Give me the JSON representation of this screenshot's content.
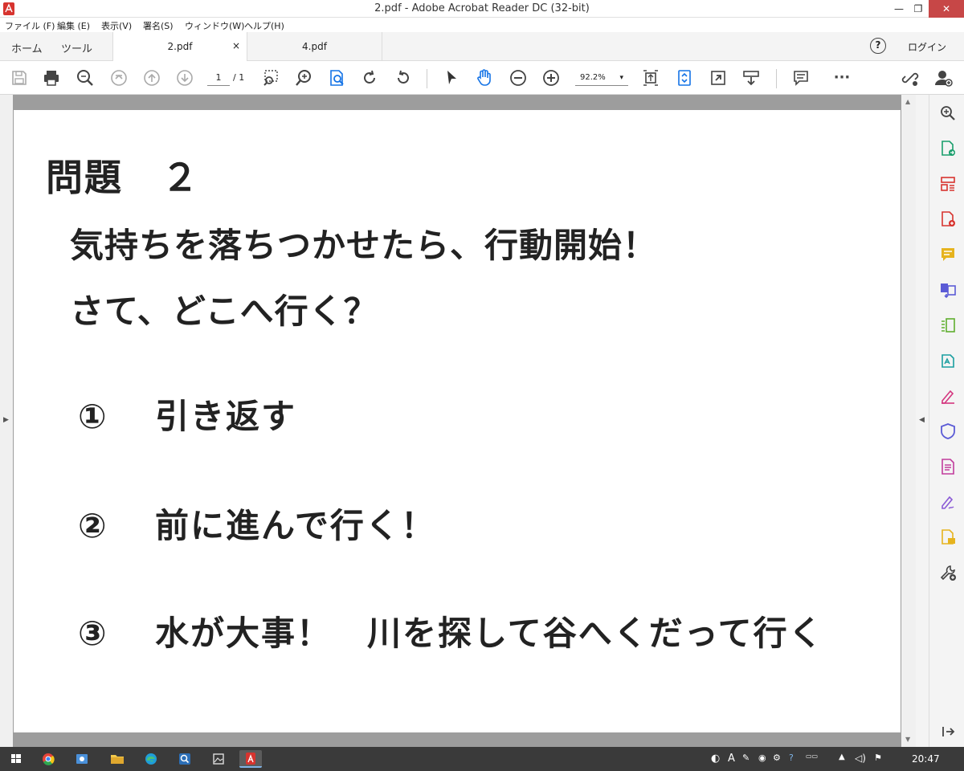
{
  "window": {
    "title": "2.pdf - Adobe Acrobat Reader DC (32-bit)",
    "min": "—",
    "max": "❐",
    "close": "✕"
  },
  "menu": [
    "ファイル (F)",
    "編集 (E)",
    "表示(V)",
    "署名(S)",
    "ウィンドウ(W)",
    "ヘルプ(H)"
  ],
  "tabs": {
    "home": "ホーム",
    "tools": "ツール",
    "doc_active": "2.pdf",
    "doc_active_close": "×",
    "doc_inactive": "4.pdf",
    "help": "?",
    "login": "ログイン"
  },
  "toolbar": {
    "page_current": "1",
    "page_total": "/ 1",
    "zoom": "92.2%",
    "zoom_caret": "▾",
    "more": "···"
  },
  "document": {
    "heading": "問題　２",
    "line1": "気持ちを落ちつかせたら、行動開始！",
    "line2": "さて、どこへ行く？",
    "options": [
      {
        "num": "①",
        "text": "引き返す"
      },
      {
        "num": "②",
        "text": "前に進んで行く！"
      },
      {
        "num": "③",
        "text": "水が大事！　川を探して谷へくだって行く"
      }
    ]
  },
  "taskbar": {
    "clock": "20:47",
    "ime": "A"
  },
  "colors": {
    "accent_blue": "#1473e6",
    "acrobat_red": "#d7342f",
    "close_red": "#c74747"
  }
}
